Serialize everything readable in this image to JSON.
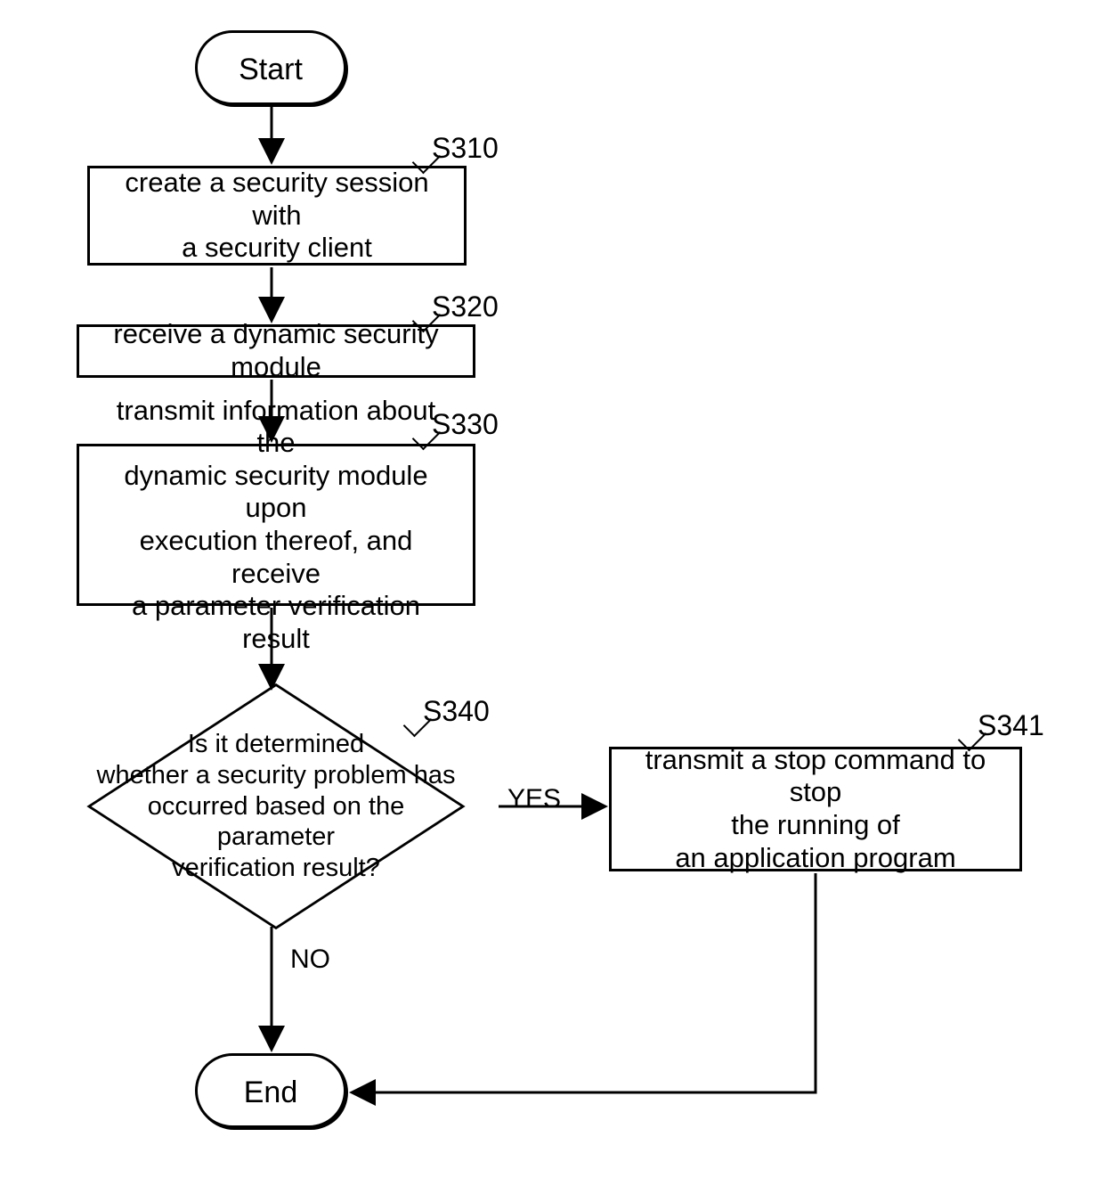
{
  "terminator": {
    "start": "Start",
    "end": "End"
  },
  "steps": {
    "s310": {
      "ref": "S310",
      "text": "create a security session with\na security client"
    },
    "s320": {
      "ref": "S320",
      "text": "receive a dynamic security module"
    },
    "s330": {
      "ref": "S330",
      "text": "transmit information about the\ndynamic security module upon\nexecution thereof, and receive\na parameter verification result"
    },
    "s340": {
      "ref": "S340",
      "text": "Is it determined\nwhether a security problem has\noccurred based on the parameter\nverification result?"
    },
    "s341": {
      "ref": "S341",
      "text": "transmit a stop command to stop\nthe running of\nan application program"
    }
  },
  "edges": {
    "yes": "YES",
    "no": "NO"
  },
  "chart_data": {
    "type": "flowchart",
    "nodes": [
      {
        "id": "start",
        "kind": "terminator",
        "label": "Start"
      },
      {
        "id": "S310",
        "kind": "process",
        "label": "create a security session with a security client"
      },
      {
        "id": "S320",
        "kind": "process",
        "label": "receive a dynamic security module"
      },
      {
        "id": "S330",
        "kind": "process",
        "label": "transmit information about the dynamic security module upon execution thereof, and receive a parameter verification result"
      },
      {
        "id": "S340",
        "kind": "decision",
        "label": "Is it determined whether a security problem has occurred based on the parameter verification result?"
      },
      {
        "id": "S341",
        "kind": "process",
        "label": "transmit a stop command to stop the running of an application program"
      },
      {
        "id": "end",
        "kind": "terminator",
        "label": "End"
      }
    ],
    "edges": [
      {
        "from": "start",
        "to": "S310"
      },
      {
        "from": "S310",
        "to": "S320"
      },
      {
        "from": "S320",
        "to": "S330"
      },
      {
        "from": "S330",
        "to": "S340"
      },
      {
        "from": "S340",
        "to": "S341",
        "label": "YES"
      },
      {
        "from": "S340",
        "to": "end",
        "label": "NO"
      },
      {
        "from": "S341",
        "to": "end"
      }
    ]
  }
}
